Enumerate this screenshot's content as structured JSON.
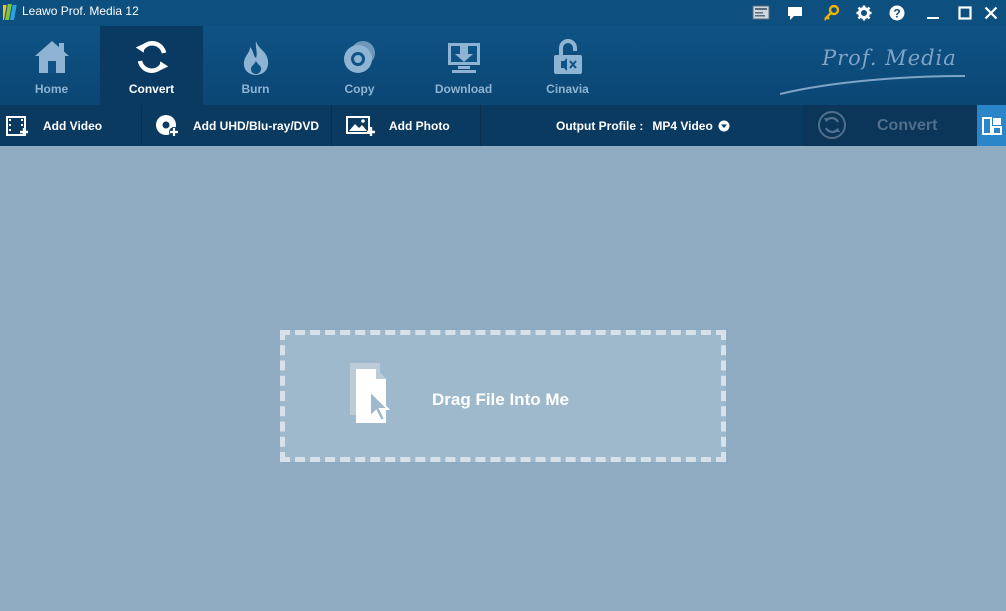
{
  "window": {
    "title": "Leawo Prof. Media 12"
  },
  "titlebar_buttons": [
    {
      "name": "screen-capture-icon"
    },
    {
      "name": "feedback-icon"
    },
    {
      "name": "register-key-icon"
    },
    {
      "name": "settings-gear-icon"
    },
    {
      "name": "help-icon"
    },
    {
      "name": "minimize-icon"
    },
    {
      "name": "maximize-icon"
    },
    {
      "name": "close-icon"
    }
  ],
  "modules": [
    {
      "label": "Home",
      "icon": "home-icon"
    },
    {
      "label": "Convert",
      "icon": "convert-icon",
      "active": true
    },
    {
      "label": "Burn",
      "icon": "burn-flame-icon"
    },
    {
      "label": "Copy",
      "icon": "copy-disc-icon"
    },
    {
      "label": "Download",
      "icon": "download-icon"
    },
    {
      "label": "Cinavia",
      "icon": "cinavia-unlock-icon"
    }
  ],
  "brand": {
    "text": "Prof. Media"
  },
  "toolbar": {
    "add_video": "Add Video",
    "add_disc": "Add UHD/Blu-ray/DVD",
    "add_photo": "Add Photo",
    "output_profile_label": "Output Profile :",
    "output_profile_value": "MP4 Video",
    "convert_label": "Convert"
  },
  "dropzone": {
    "text": "Drag File Into Me"
  },
  "colors": {
    "titlebar": "#0d4f7f",
    "module_bar": "#0e5385",
    "module_active": "#0a3a62",
    "toolbar": "#0b3a61",
    "workspace": "#8eabc2",
    "accent": "#2a86c8",
    "key_icon": "#f2b200"
  }
}
